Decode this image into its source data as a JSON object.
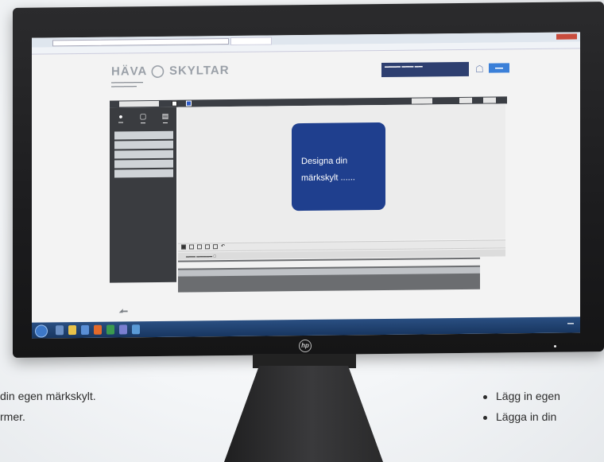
{
  "monitor": {
    "sign_text_line1": "Designa din",
    "sign_text_line2": "märkskylt ......",
    "colors": {
      "sign": "#1f3f8e",
      "bezel": "#1c1c1e",
      "taskbar": "#183660",
      "login": "#3a7fd8"
    },
    "brand_icon": "hp-logo-icon"
  },
  "left_caption": {
    "line1": "din egen märkskylt.",
    "line2": "rmer."
  },
  "right_list": {
    "item1": "Lägg in egen",
    "item2": "Lägga in din"
  }
}
